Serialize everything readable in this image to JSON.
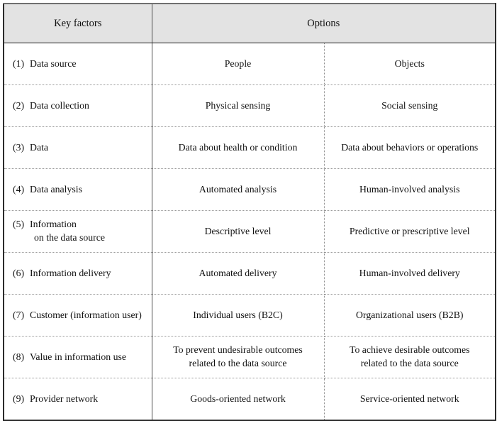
{
  "table": {
    "header": {
      "key_factors": "Key factors",
      "options": "Options"
    },
    "rows": [
      {
        "num": "(1)",
        "factor": "Data source",
        "factor_line2": "",
        "option_a_line1": "People",
        "option_a_line2": "",
        "option_b_line1": "Objects",
        "option_b_line2": ""
      },
      {
        "num": "(2)",
        "factor": "Data collection",
        "factor_line2": "",
        "option_a_line1": "Physical sensing",
        "option_a_line2": "",
        "option_b_line1": "Social sensing",
        "option_b_line2": ""
      },
      {
        "num": "(3)",
        "factor": "Data",
        "factor_line2": "",
        "option_a_line1": "Data about health or condition",
        "option_a_line2": "",
        "option_b_line1": "Data about behaviors or operations",
        "option_b_line2": ""
      },
      {
        "num": "(4)",
        "factor": "Data analysis",
        "factor_line2": "",
        "option_a_line1": "Automated analysis",
        "option_a_line2": "",
        "option_b_line1": "Human-involved  analysis",
        "option_b_line2": ""
      },
      {
        "num": "(5)",
        "factor": "Information",
        "factor_line2": "on the data source",
        "option_a_line1": "Descriptive level",
        "option_a_line2": "",
        "option_b_line1": "Predictive or prescriptive level",
        "option_b_line2": ""
      },
      {
        "num": "(6)",
        "factor": "Information delivery",
        "factor_line2": "",
        "option_a_line1": "Automated delivery",
        "option_a_line2": "",
        "option_b_line1": "Human-involved  delivery",
        "option_b_line2": ""
      },
      {
        "num": "(7)",
        "factor": "Customer (information user)",
        "factor_line2": "",
        "option_a_line1": "Individual  users (B2C)",
        "option_a_line2": "",
        "option_b_line1": "Organizational  users (B2B)",
        "option_b_line2": ""
      },
      {
        "num": "(8)",
        "factor": "Value in information use",
        "factor_line2": "",
        "option_a_line1": "To prevent undesirable outcomes",
        "option_a_line2": "related to the data source",
        "option_b_line1": "To achieve desirable outcomes",
        "option_b_line2": "related to the data source"
      },
      {
        "num": "(9)",
        "factor": "Provider network",
        "factor_line2": "",
        "option_a_line1": "Goods-oriented network",
        "option_a_line2": "",
        "option_b_line1": "Service-oriented network",
        "option_b_line2": ""
      }
    ]
  },
  "colors": {
    "header_background": "#e3e3e3",
    "border_solid": "#2b2b2b",
    "border_dotted": "#9a9a9a",
    "text": "#111111"
  }
}
